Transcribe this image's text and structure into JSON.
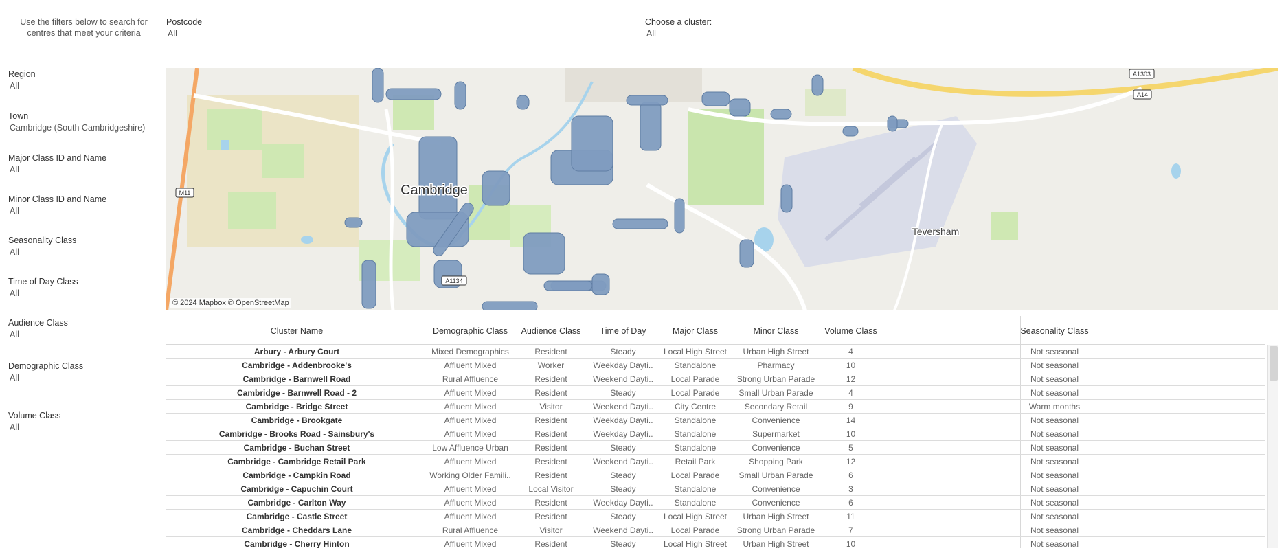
{
  "intro_text": "Use the filters below to search for centres that meet your criteria",
  "filters_top": [
    {
      "id": "postcode",
      "label": "Postcode",
      "value": "All"
    },
    {
      "id": "cluster",
      "label": "Choose a cluster:",
      "value": "All"
    }
  ],
  "filters_side": [
    {
      "id": "region",
      "label": "Region",
      "value": "All"
    },
    {
      "id": "town",
      "label": "Town",
      "value": "Cambridge (South Cambridgeshire)"
    },
    {
      "id": "major-class",
      "label": "Major Class ID and Name",
      "value": "All"
    },
    {
      "id": "minor-class",
      "label": "Minor Class ID and Name",
      "value": "All"
    },
    {
      "id": "seasonality",
      "label": "Seasonality Class",
      "value": "All"
    },
    {
      "id": "time-of-day",
      "label": "Time of Day Class",
      "value": "All"
    },
    {
      "id": "audience",
      "label": "Audience Class",
      "value": "All"
    },
    {
      "id": "demographic",
      "label": "Demographic Class",
      "value": "All"
    },
    {
      "id": "volume",
      "label": "Volume Class",
      "value": "All"
    }
  ],
  "map": {
    "place_labels": [
      "Cambridge",
      "Teversham"
    ],
    "road_labels": [
      "A1303",
      "A14",
      "M11",
      "A1134"
    ],
    "credit": "© 2024 Mapbox © OpenStreetMap",
    "cluster_color": "#7f9cc0"
  },
  "table": {
    "columns": [
      "Cluster Name",
      "Demographic Class",
      "Audience Class",
      "Time of Day",
      "Major Class",
      "Minor Class",
      "Volume Class",
      "Seasonality Class"
    ],
    "rows": [
      [
        "Arbury - Arbury Court",
        "Mixed Demographics",
        "Resident",
        "Steady",
        "Local High Street",
        "Urban High Street",
        "4",
        "Not seasonal"
      ],
      [
        "Cambridge - Addenbrooke's",
        "Affluent Mixed",
        "Worker",
        "Weekday Dayti..",
        "Standalone",
        "Pharmacy",
        "10",
        "Not seasonal"
      ],
      [
        "Cambridge - Barnwell Road",
        "Rural Affluence",
        "Resident",
        "Weekend Dayti..",
        "Local Parade",
        "Strong Urban Parade",
        "12",
        "Not seasonal"
      ],
      [
        "Cambridge - Barnwell Road - 2",
        "Affluent Mixed",
        "Resident",
        "Steady",
        "Local Parade",
        "Small Urban Parade",
        "4",
        "Not seasonal"
      ],
      [
        "Cambridge - Bridge Street",
        "Affluent Mixed",
        "Visitor",
        "Weekend Dayti..",
        "City Centre",
        "Secondary Retail",
        "9",
        "Warm months"
      ],
      [
        "Cambridge - Brookgate",
        "Affluent Mixed",
        "Resident",
        "Weekday Dayti..",
        "Standalone",
        "Convenience",
        "14",
        "Not seasonal"
      ],
      [
        "Cambridge - Brooks Road - Sainsbury's",
        "Affluent Mixed",
        "Resident",
        "Weekday Dayti..",
        "Standalone",
        "Supermarket",
        "10",
        "Not seasonal"
      ],
      [
        "Cambridge - Buchan Street",
        "Low Affluence Urban",
        "Resident",
        "Steady",
        "Standalone",
        "Convenience",
        "5",
        "Not seasonal"
      ],
      [
        "Cambridge - Cambridge Retail Park",
        "Affluent Mixed",
        "Resident",
        "Weekend Dayti..",
        "Retail Park",
        "Shopping Park",
        "12",
        "Not seasonal"
      ],
      [
        "Cambridge - Campkin Road",
        "Working Older Famili..",
        "Resident",
        "Steady",
        "Local Parade",
        "Small Urban Parade",
        "6",
        "Not seasonal"
      ],
      [
        "Cambridge - Capuchin Court",
        "Affluent Mixed",
        "Local Visitor",
        "Steady",
        "Standalone",
        "Convenience",
        "3",
        "Not seasonal"
      ],
      [
        "Cambridge - Carlton Way",
        "Affluent Mixed",
        "Resident",
        "Weekday Dayti..",
        "Standalone",
        "Convenience",
        "6",
        "Not seasonal"
      ],
      [
        "Cambridge - Castle Street",
        "Affluent Mixed",
        "Resident",
        "Steady",
        "Local High Street",
        "Urban High Street",
        "11",
        "Not seasonal"
      ],
      [
        "Cambridge - Cheddars Lane",
        "Rural Affluence",
        "Visitor",
        "Weekend Dayti..",
        "Local Parade",
        "Strong Urban Parade",
        "7",
        "Not seasonal"
      ],
      [
        "Cambridge - Cherry Hinton",
        "Affluent Mixed",
        "Resident",
        "Steady",
        "Local High Street",
        "Urban High Street",
        "10",
        "Not seasonal"
      ]
    ]
  }
}
